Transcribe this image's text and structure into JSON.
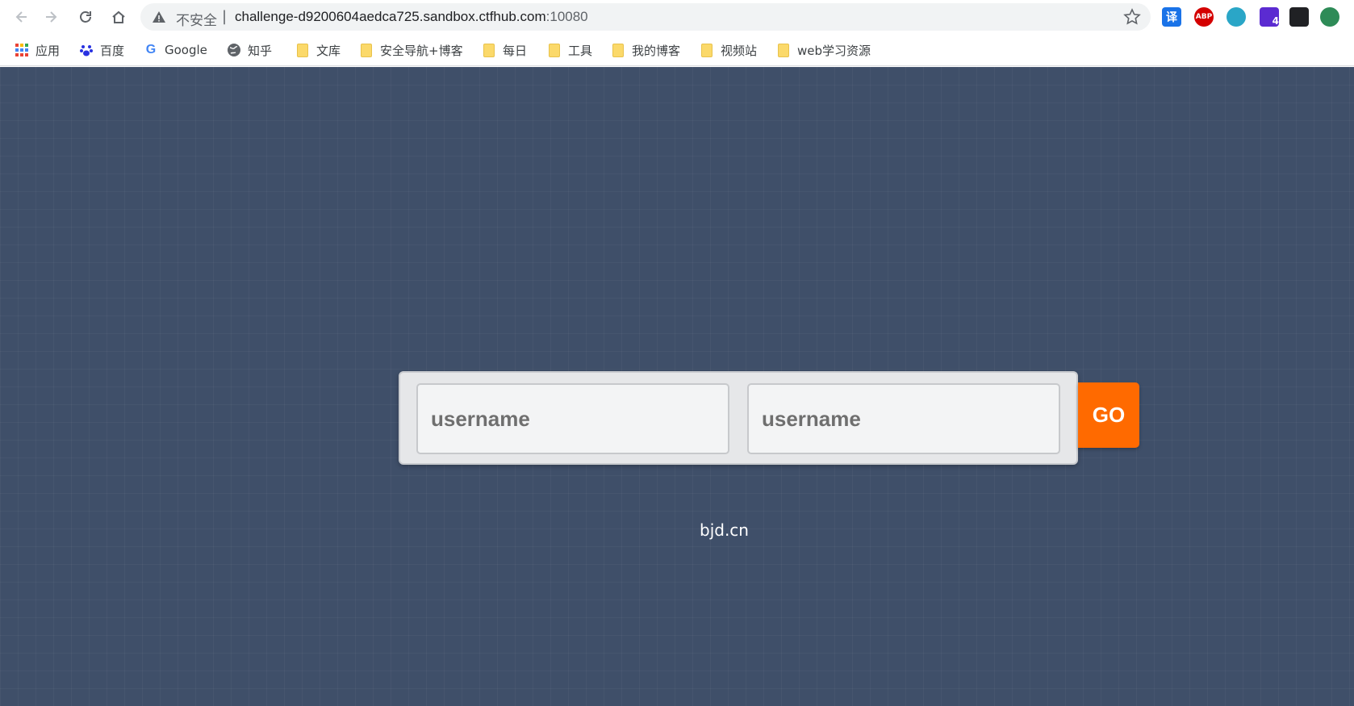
{
  "browser": {
    "address_bar": {
      "security_label": "不安全",
      "separator": "|",
      "url_host": "challenge-d9200604aedca725.sandbox.ctfhub.com",
      "url_port": ":10080"
    },
    "extensions": [
      {
        "name": "translate-extension-icon",
        "text": "译",
        "color": "#1a73e8"
      },
      {
        "name": "adblock-plus-icon",
        "text": "ABP",
        "color": "#d40000"
      },
      {
        "name": "circle-extension-icon",
        "text": "",
        "color": "#2aa6c7"
      },
      {
        "name": "stack-extension-icon",
        "text": "4",
        "color": "#5b2bd1"
      },
      {
        "name": "glasses-extension-icon",
        "text": "",
        "color": "#202124"
      },
      {
        "name": "globe-extension-icon",
        "text": "",
        "color": "#2e8b57"
      }
    ],
    "bookmarks": [
      {
        "label": "应用",
        "icon": "apps-grid-icon"
      },
      {
        "label": "百度",
        "icon": "baidu-icon"
      },
      {
        "label": "Google",
        "icon": "google-icon"
      },
      {
        "label": "知乎",
        "icon": "globe-icon"
      },
      {
        "label": "文库",
        "icon": "folder-icon"
      },
      {
        "label": "安全导航+博客",
        "icon": "folder-icon"
      },
      {
        "label": "每日",
        "icon": "folder-icon"
      },
      {
        "label": "工具",
        "icon": "folder-icon"
      },
      {
        "label": "我的博客",
        "icon": "folder-icon"
      },
      {
        "label": "视频站",
        "icon": "folder-icon"
      },
      {
        "label": "web学习资源",
        "icon": "folder-icon"
      }
    ]
  },
  "page": {
    "background_color": "#3f4f69",
    "login": {
      "field1_placeholder": "username",
      "field2_placeholder": "username",
      "go_label": "GO",
      "go_color": "#ff6a00"
    },
    "footer": "bjd.cn"
  }
}
